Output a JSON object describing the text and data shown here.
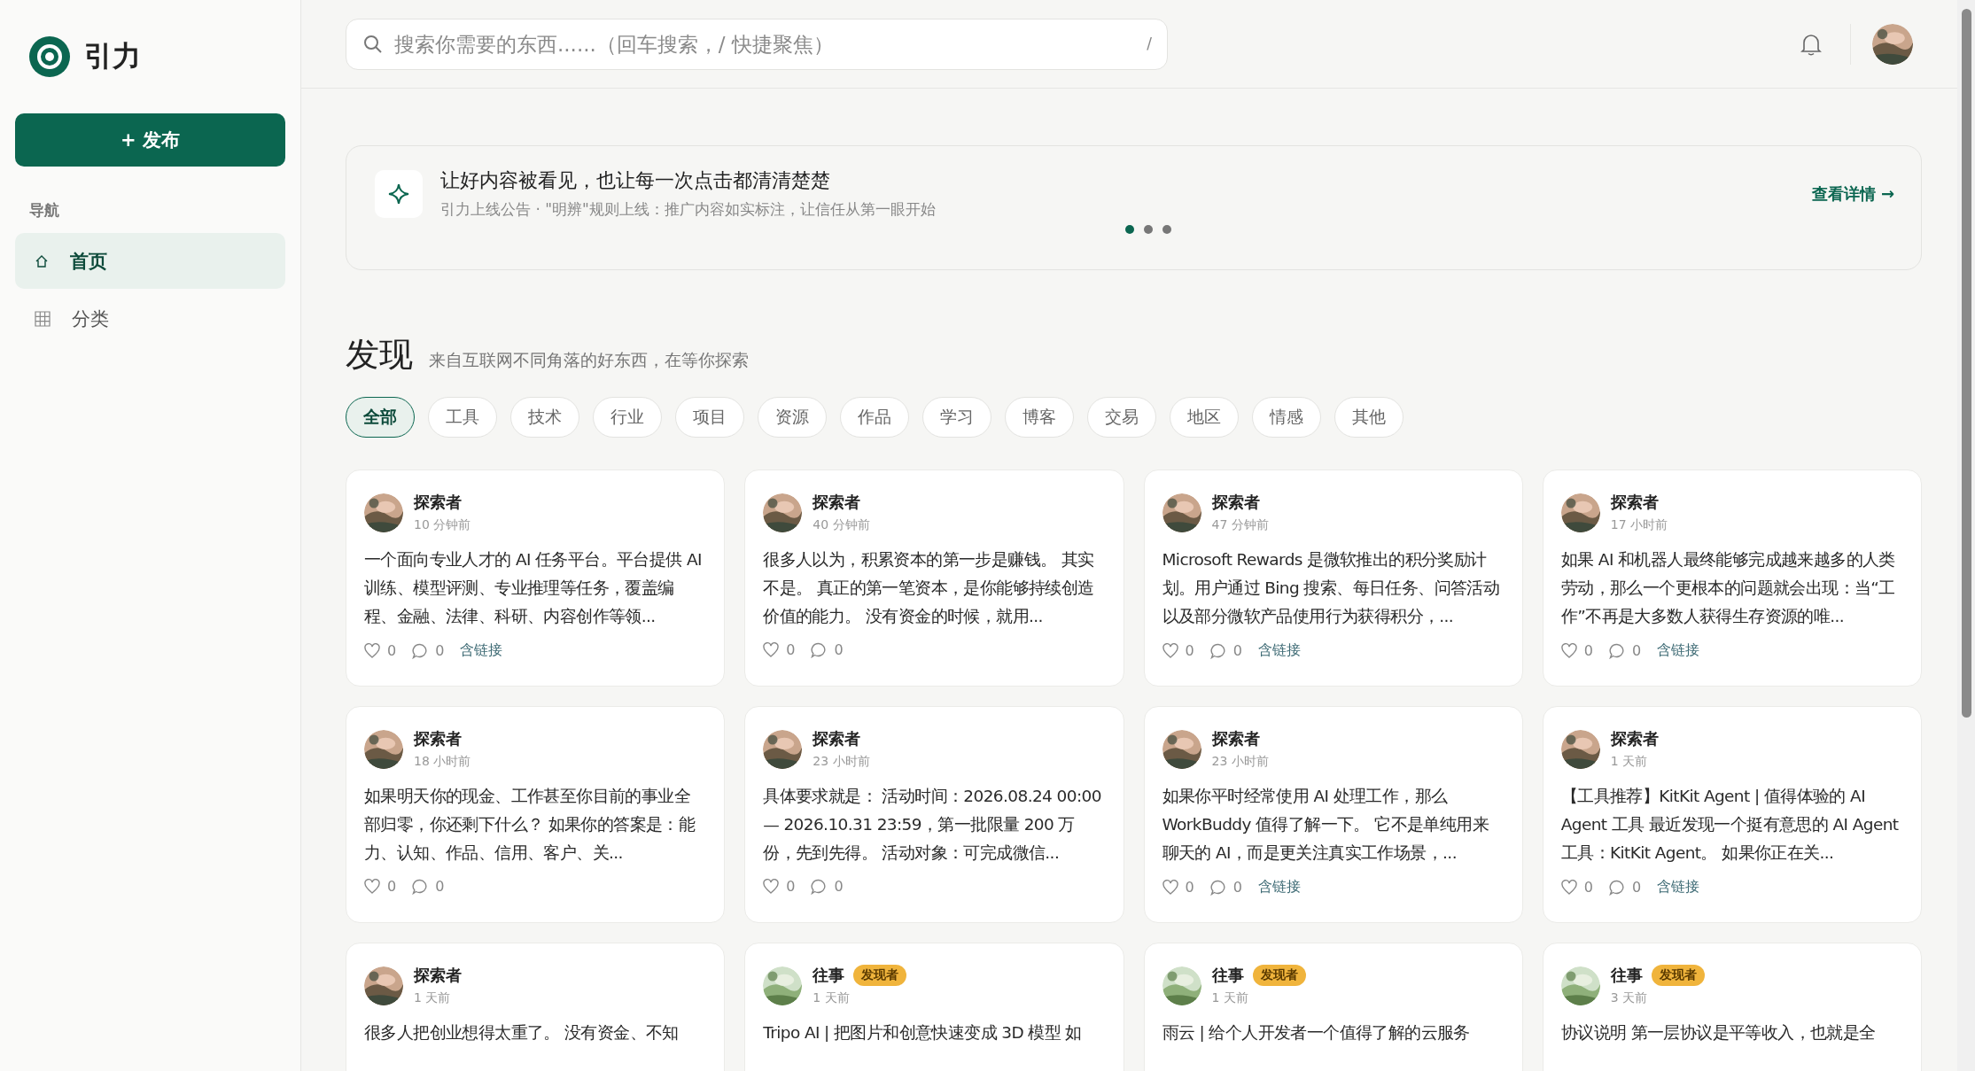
{
  "brand": {
    "name": "引力"
  },
  "publish_button": "+ 发布",
  "nav": {
    "heading": "导航",
    "items": [
      {
        "label": "首页",
        "kind": "home",
        "selected": true
      },
      {
        "label": "分类",
        "kind": "grid",
        "selected": false
      }
    ]
  },
  "search": {
    "placeholder": "搜索你需要的东西......（回车搜索，/ 快捷聚焦）",
    "shortcut": "/"
  },
  "banner": {
    "title": "让好内容被看见，也让每一次点击都清清楚楚",
    "subtitle": "引力上线公告 · \"明辨\"规则上线：推广内容如实标注，让信任从第一眼开始",
    "link": "查看详情 →",
    "dots": [
      {
        "selected": true
      },
      {
        "selected": false
      },
      {
        "selected": false
      }
    ]
  },
  "discover": {
    "title": "发现",
    "subtitle": "来自互联网不同角落的好东西，在等你探索"
  },
  "tags": [
    {
      "label": "全部",
      "selected": true
    },
    {
      "label": "工具",
      "selected": false
    },
    {
      "label": "技术",
      "selected": false
    },
    {
      "label": "行业",
      "selected": false
    },
    {
      "label": "项目",
      "selected": false
    },
    {
      "label": "资源",
      "selected": false
    },
    {
      "label": "作品",
      "selected": false
    },
    {
      "label": "学习",
      "selected": false
    },
    {
      "label": "博客",
      "selected": false
    },
    {
      "label": "交易",
      "selected": false
    },
    {
      "label": "地区",
      "selected": false
    },
    {
      "label": "情感",
      "selected": false
    },
    {
      "label": "其他",
      "selected": false
    }
  ],
  "posts": [
    {
      "author": "探索者",
      "time": "10 分钟前",
      "body": "一个面向专业人才的 AI 任务平台。平台提供 AI 训练、模型评测、专业推理等任务，覆盖编程、金融、法律、科研、内容创作等领...",
      "likes": "0",
      "comments": "0",
      "link_tag": "含链接"
    },
    {
      "author": "探索者",
      "time": "40 分钟前",
      "body": "很多人以为，积累资本的第一步是赚钱。 其实不是。 真正的第一笔资本，是你能够持续创造价值的能力。 没有资金的时候，就用...",
      "likes": "0",
      "comments": "0"
    },
    {
      "author": "探索者",
      "time": "47 分钟前",
      "body": "Microsoft Rewards 是微软推出的积分奖励计划。用户通过 Bing 搜索、每日任务、问答活动以及部分微软产品使用行为获得积分，...",
      "likes": "0",
      "comments": "0",
      "link_tag": "含链接"
    },
    {
      "author": "探索者",
      "time": "17 小时前",
      "body": "如果 AI 和机器人最终能够完成越来越多的人类劳动，那么一个更根本的问题就会出现：当“工作”不再是大多数人获得生存资源的唯...",
      "likes": "0",
      "comments": "0",
      "link_tag": "含链接"
    },
    {
      "author": "探索者",
      "time": "18 小时前",
      "body": "如果明天你的现金、工作甚至你目前的事业全部归零，你还剩下什么？ 如果你的答案是：能力、认知、作品、信用、客户、关...",
      "likes": "0",
      "comments": "0"
    },
    {
      "author": "探索者",
      "time": "23 小时前",
      "body": "具体要求就是： 活动时间：2026.08.24 00:00 — 2026.10.31 23:59，第一批限量 200 万份，先到先得。 活动对象：可完成微信...",
      "likes": "0",
      "comments": "0"
    },
    {
      "author": "探索者",
      "time": "23 小时前",
      "body": "如果你平时经常使用 AI 处理工作，那么 WorkBuddy 值得了解一下。 它不是单纯用来聊天的 AI，而是更关注真实工作场景，...",
      "likes": "0",
      "comments": "0",
      "link_tag": "含链接"
    },
    {
      "author": "探索者",
      "time": "1 天前",
      "body": "【工具推荐】KitKit Agent | 值得体验的 AI Agent 工具 最近发现一个挺有意思的 AI Agent 工具：KitKit Agent。 如果你正在关...",
      "likes": "0",
      "comments": "0",
      "link_tag": "含链接"
    },
    {
      "author": "探索者",
      "time": "1 天前",
      "body": "很多人把创业想得太重了。 没有资金、不知"
    },
    {
      "author": "往事",
      "badge": "发现者",
      "time": "1 天前",
      "body": "Tripo AI | 把图片和创意快速变成 3D 模型 如"
    },
    {
      "author": "往事",
      "badge": "发现者",
      "time": "1 天前",
      "body": "雨云 | 给个人开发者一个值得了解的云服务"
    },
    {
      "author": "往事",
      "badge": "发现者",
      "time": "3 天前",
      "body": "协议说明 第一层协议是平等收入，也就是全"
    }
  ]
}
